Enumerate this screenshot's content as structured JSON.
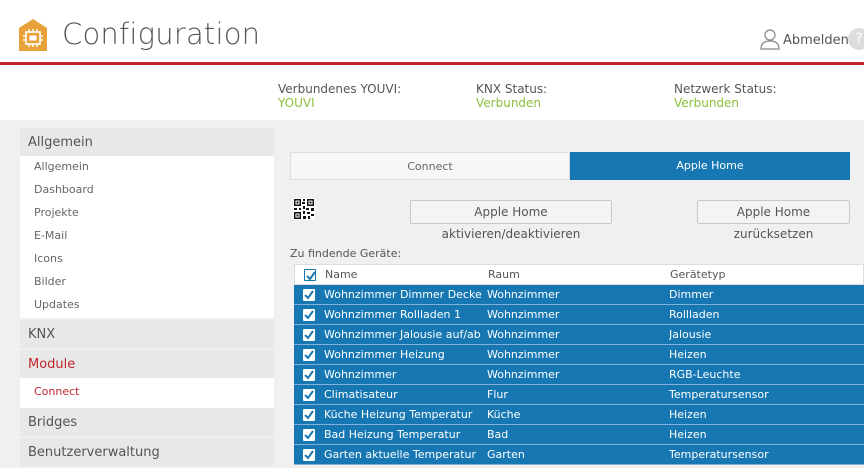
{
  "header": {
    "title": "Configuration",
    "logout_label": "Abmelden",
    "help_label": "?"
  },
  "status": {
    "youvi_label": "Verbundenes YOUVI:",
    "youvi_value": "YOUVI",
    "knx_label": "KNX Status:",
    "knx_value": "Verbunden",
    "network_label": "Netzwerk Status:",
    "network_value": "Verbunden"
  },
  "sidebar": {
    "allgemein_head": "Allgemein",
    "allgemein_items": [
      "Allgemein",
      "Dashboard",
      "Projekte",
      "E-Mail",
      "Icons",
      "Bilder",
      "Updates"
    ],
    "knx_head": "KNX",
    "module_head": "Module",
    "module_items": [
      "Connect"
    ],
    "bridges_head": "Bridges",
    "users_head": "Benutzerverwaltung"
  },
  "tabs": {
    "connect": "Connect",
    "apple_home": "Apple Home"
  },
  "buttons": {
    "toggle": "Apple Home aktivieren/deaktivieren",
    "reset": "Apple Home zurücksetzen"
  },
  "devices_label": "Zu findende Geräte:",
  "table": {
    "headers": [
      "Name",
      "Raum",
      "Gerätetyp"
    ],
    "rows": [
      [
        "Wohnzimmer Dimmer Decke",
        "Wohnzimmer",
        "Dimmer"
      ],
      [
        "Wohnzimmer Rollladen 1",
        "Wohnzimmer",
        "Rollladen"
      ],
      [
        "Wohnzimmer Jalousie auf/ab",
        "Wohnzimmer",
        "Jalousie"
      ],
      [
        "Wohnzimmer Heizung",
        "Wohnzimmer",
        "Heizen"
      ],
      [
        "Wohnzimmer",
        "Wohnzimmer",
        "RGB-Leuchte"
      ],
      [
        "Climatisateur",
        "Flur",
        "Temperatursensor"
      ],
      [
        "Küche Heizung Temperatur",
        "Küche",
        "Heizen"
      ],
      [
        "Bad Heizung Temperatur",
        "Bad",
        "Heizen"
      ],
      [
        "Garten aktuelle Temperatur",
        "Garten",
        "Temperatursensor"
      ]
    ]
  },
  "colors": {
    "accent_blue": "#1677b3",
    "brand_red": "#c0272d",
    "status_green": "#8bbf3c",
    "logo_orange": "#e8a23a"
  }
}
